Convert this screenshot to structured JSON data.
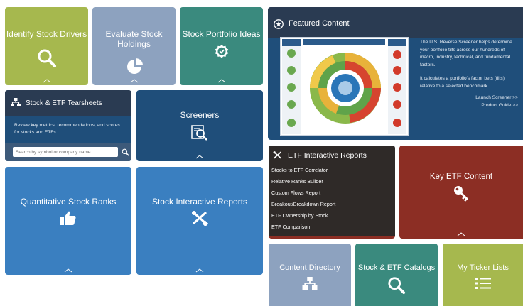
{
  "tiles": {
    "identify_drivers": {
      "title": "Identify Stock Drivers",
      "icon": "search-icon",
      "color": "#a6b84e"
    },
    "evaluate_holdings": {
      "title": "Evaluate Stock Holdings",
      "icon": "pie-chart-icon",
      "color": "#8da2bf"
    },
    "portfolio_ideas": {
      "title": "Stock Portfolio Ideas",
      "icon": "badge-check-icon",
      "color": "#3a8a7e"
    },
    "screeners": {
      "title": "Screeners",
      "icon": "screener-search-icon",
      "color": "#1f4e7a"
    },
    "quant_ranks": {
      "title": "Quantitative Stock Ranks",
      "icon": "thumbs-up-icon",
      "color": "#3a7fc0"
    },
    "stock_interactive": {
      "title": "Stock Interactive Reports",
      "icon": "tools-icon",
      "color": "#3a7fc0"
    },
    "key_etf": {
      "title": "Key ETF Content",
      "icon": "key-icon",
      "color": "#8c2e24"
    },
    "content_directory": {
      "title": "Content Directory",
      "icon": "sitemap-icon",
      "color": "#8da2bf"
    },
    "catalogs": {
      "title": "Stock & ETF Catalogs",
      "icon": "search-icon",
      "color": "#3a8a7e"
    },
    "ticker_lists": {
      "title": "My Ticker Lists",
      "icon": "list-icon",
      "color": "#a6b84e"
    }
  },
  "tearsheets": {
    "title": "Stock & ETF Tearsheets",
    "description": "Review key metrics, recommendations, and scores for stocks and ETFs.",
    "search_placeholder": "Search by symbol or company name",
    "color": "#1f4e7a"
  },
  "featured": {
    "title": "Featured Content",
    "paragraph1": "The U.S. Reverse Screener helps determine your portfolio tilts across our hundreds of macro, industry, technical, and fundamental factors.",
    "paragraph2": "It calculates a portfolio's factor bets (tilts) relative to a selected benchmark.",
    "link1": "Launch Screener >>",
    "link2": "Product Guide >>",
    "color": "#1f4e7a"
  },
  "etf_reports": {
    "title": "ETF Interactive Reports",
    "color": "#2f2a28",
    "items": [
      "Stocks to ETF Correlator",
      "Relative Ranks Builder",
      "Custom Flows Report",
      "Breakout/Breakdown Report",
      "ETF Ownership by Stock",
      "ETF Comparison"
    ]
  }
}
